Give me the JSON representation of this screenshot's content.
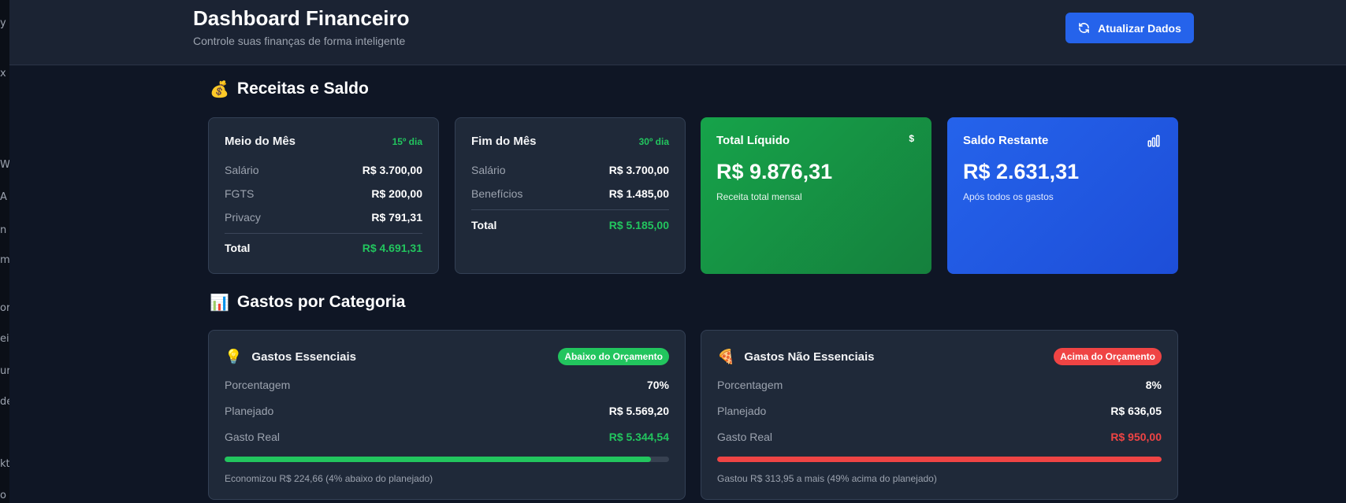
{
  "left_strip": [
    "y",
    "x",
    "W",
    "A",
    "n",
    "m",
    "or",
    "ei",
    "ur",
    "de",
    "kt",
    "o"
  ],
  "header": {
    "title": "Dashboard Financeiro",
    "subtitle": "Controle suas finanças de forma inteligente",
    "refresh_button": {
      "label": "Atualizar Dados",
      "icon": "refresh-icon"
    }
  },
  "income_section": {
    "icon": "💰",
    "title": "Receitas e Saldo",
    "mid_month": {
      "title": "Meio do Mês",
      "day_tag": "15º dia",
      "rows": [
        {
          "label": "Salário",
          "value": "R$ 3.700,00"
        },
        {
          "label": "FGTS",
          "value": "R$ 200,00"
        },
        {
          "label": "Privacy",
          "value": "R$ 791,31"
        }
      ],
      "total_label": "Total",
      "total_value": "R$ 4.691,31"
    },
    "end_month": {
      "title": "Fim do Mês",
      "day_tag": "30º dia",
      "rows": [
        {
          "label": "Salário",
          "value": "R$ 3.700,00"
        },
        {
          "label": "Benefícios",
          "value": "R$ 1.485,00"
        }
      ],
      "total_label": "Total",
      "total_value": "R$ 5.185,00"
    },
    "net_total": {
      "title": "Total Líquido",
      "icon_text": "$",
      "amount": "R$ 9.876,31",
      "caption": "Receita total mensal",
      "color": "#16a34a"
    },
    "remaining_balance": {
      "title": "Saldo Restante",
      "icon": "bar-chart-icon",
      "amount": "R$ 2.631,31",
      "caption": "Após todos os gastos",
      "color": "#2563eb"
    }
  },
  "expenses_section": {
    "icon": "📊",
    "title": "Gastos por Categoria",
    "essential": {
      "icon": "💡",
      "title": "Gastos Essenciais",
      "badge": "Abaixo do Orçamento",
      "badge_color": "#22c55e",
      "percentage_label": "Porcentagem",
      "percentage_value": "70%",
      "planned_label": "Planejado",
      "planned_value": "R$ 5.569,20",
      "actual_label": "Gasto Real",
      "actual_value": "R$ 5.344,54",
      "progress": 0.96,
      "note": "Economizou R$ 224,66 (4% abaixo do planejado)"
    },
    "non_essential": {
      "icon": "🍕",
      "title": "Gastos Não Essenciais",
      "badge": "Acima do Orçamento",
      "badge_color": "#ef4444",
      "percentage_label": "Porcentagem",
      "percentage_value": "8%",
      "planned_label": "Planejado",
      "planned_value": "R$ 636,05",
      "actual_label": "Gasto Real",
      "actual_value": "R$ 950,00",
      "progress": 1.0,
      "note": "Gastou R$ 313,95 a mais (49% acima do planejado)"
    }
  }
}
